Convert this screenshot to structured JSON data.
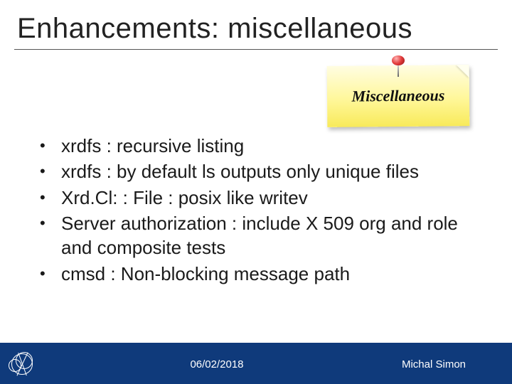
{
  "title": "Enhancements: miscellaneous",
  "sticky": {
    "label": "Miscellaneous"
  },
  "bullets": [
    "xrdfs : recursive listing",
    "xrdfs : by default ls outputs only unique files",
    "Xrd.Cl: : File : posix like writev",
    "Server authorization : include X 509 org and role and composite tests",
    "cmsd : Non-blocking message path"
  ],
  "footer": {
    "date": "06/02/2018",
    "author": "Michal Simon"
  }
}
